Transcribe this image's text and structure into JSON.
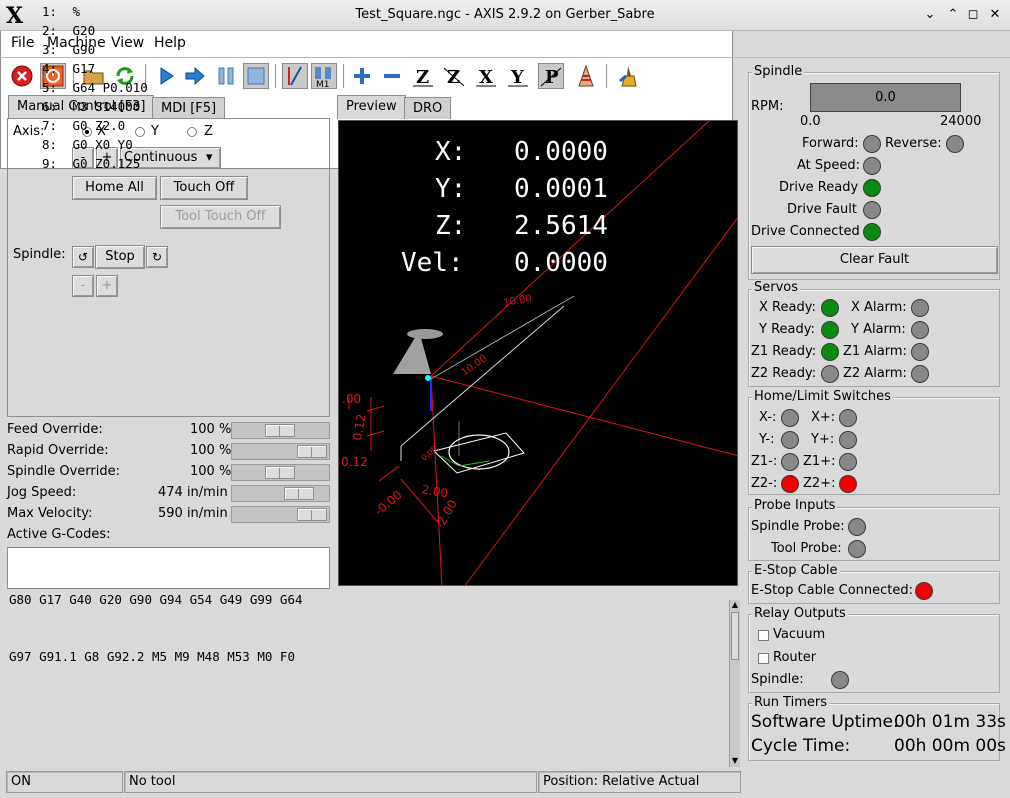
{
  "window": {
    "title": "Test_Square.ngc - AXIS 2.9.2 on Gerber_Sabre",
    "logo": "X",
    "minimize": "⌄",
    "maximize": "⌃",
    "restore": "◻",
    "close": "✕"
  },
  "menu": {
    "file": "File",
    "machine": "Machine",
    "view": "View",
    "help": "Help"
  },
  "toolbar": {
    "icons": [
      "estop-icon",
      "power-icon",
      "open-file-icon",
      "reload-icon",
      "run-icon",
      "step-icon",
      "pause-icon",
      "stop-icon",
      "block-delete-icon",
      "optional-stop-icon",
      "zoom-in-icon",
      "zoom-out-icon",
      "view-z-icon",
      "view-z2-icon",
      "view-x-icon",
      "view-y-icon",
      "view-p-icon",
      "rotate-icon",
      "clear-plot-icon"
    ],
    "labels": {
      "view_z": "Z",
      "view_z2": "Z",
      "view_x": "X",
      "view_y": "Y",
      "view_p": "P",
      "m1": "M1"
    }
  },
  "tabs_left": {
    "manual": "Manual Control [F3]",
    "mdi": "MDI [F5]"
  },
  "tabs_center": {
    "preview": "Preview",
    "dro": "DRO"
  },
  "manual": {
    "axis_label": "Axis:",
    "axes": [
      "X",
      "Y",
      "Z"
    ],
    "selected_axis": "X",
    "minus": "-",
    "plus": "+",
    "jog_mode": "Continuous",
    "home_all": "Home All",
    "touch_off": "Touch Off",
    "tool_touch_off": "Tool Touch Off",
    "spindle_label": "Spindle:",
    "spindle_stop": "Stop"
  },
  "overrides": [
    {
      "label": "Feed Override:",
      "value": "100 %"
    },
    {
      "label": "Rapid Override:",
      "value": "100 %"
    },
    {
      "label": "Spindle Override:",
      "value": "100 %"
    },
    {
      "label": "Jog Speed:",
      "value": "474 in/min"
    },
    {
      "label": "Max Velocity:",
      "value": "590 in/min"
    }
  ],
  "override_levels": {
    "feed": 0.5,
    "rapid": 1.0,
    "spindle": 0.5,
    "jog": 0.8,
    "max_velocity": 1.0
  },
  "gcodes": {
    "label": "Active G-Codes:",
    "line1": "G80 G17 G40 G20 G90 G94 G54 G49 G99 G64",
    "line2": "G97 G91.1 G8 G92.2 M5 M9 M48 M53 M0 F0"
  },
  "dro": {
    "x_label": "X:",
    "x": "0.0000",
    "y_label": "Y:",
    "y": "0.0001",
    "z_label": "Z:",
    "z": "2.5614",
    "vel_label": "Vel:",
    "vel": "0.0000"
  },
  "preview_labels": {
    "x_dim": "10.00",
    "y_dim": "10.00",
    "a1": ".00",
    "a2": "0.12",
    "a3": "0.12",
    "a4": "-0.00",
    "a5": "2.00",
    "a6": "2.00",
    "a7": "0.00"
  },
  "program": [
    {
      "n": "1:",
      "code": "%"
    },
    {
      "n": "2:",
      "code": "G20"
    },
    {
      "n": "3:",
      "code": "G90"
    },
    {
      "n": "4:",
      "code": "G17"
    },
    {
      "n": "5:",
      "code": "G64 P0.010"
    },
    {
      "n": "6:",
      "code": "M3 S14000"
    },
    {
      "n": "7:",
      "code": "G0 Z2.0"
    },
    {
      "n": "8:",
      "code": "G0 X0 Y0"
    },
    {
      "n": "9:",
      "code": "G0 Z0.125"
    }
  ],
  "status": {
    "state": "ON",
    "tool": "No tool",
    "position": "Position: Relative Actual"
  },
  "spindle_panel": {
    "title": "Spindle",
    "rpm_label": "RPM:",
    "rpm": "0.0",
    "rpm_min": "0.0",
    "rpm_max": "24000",
    "forward": "Forward:",
    "reverse": "Reverse:",
    "at_speed": "At Speed:",
    "drive_ready": "Drive Ready",
    "drive_fault": "Drive Fault",
    "drive_connected": "Drive Connected",
    "clear_fault": "Clear Fault",
    "colors": {
      "forward": "#888888",
      "reverse": "#888888",
      "at_speed": "#888888",
      "drive_ready": "#0b8a12",
      "drive_fault": "#888888",
      "drive_connected": "#0b8a12"
    }
  },
  "servos": {
    "title": "Servos",
    "rows": [
      {
        "ready": "X Ready:",
        "alarm": "X Alarm:"
      },
      {
        "ready": "Y Ready:",
        "alarm": "Y Alarm:"
      },
      {
        "ready": "Z1 Ready:",
        "alarm": "Z1 Alarm:"
      },
      {
        "ready": "Z2 Ready:",
        "alarm": "Z2 Alarm:"
      }
    ],
    "ready_colors": [
      "#0b8a12",
      "#0b8a12",
      "#0b8a12",
      "#888888"
    ],
    "alarm_colors": [
      "#888888",
      "#888888",
      "#888888",
      "#888888"
    ]
  },
  "limits": {
    "title": "Home/Limit Switches",
    "rows": [
      {
        "a": "X-:",
        "b": "X+:"
      },
      {
        "a": "Y-:",
        "b": "Y+:"
      },
      {
        "a": "Z1-:",
        "b": "Z1+:"
      },
      {
        "a": "Z2-:",
        "b": "Z2+:"
      }
    ],
    "a_colors": [
      "#888888",
      "#888888",
      "#888888",
      "#f20000"
    ],
    "b_colors": [
      "#888888",
      "#888888",
      "#888888",
      "#f20000"
    ]
  },
  "probe": {
    "title": "Probe Inputs",
    "spindle_probe": "Spindle Probe:",
    "tool_probe": "Tool Probe:"
  },
  "estop": {
    "title": "E-Stop Cable",
    "connected": "E-Stop Cable Connected:",
    "color": "#f20000"
  },
  "relay": {
    "title": "Relay Outputs",
    "vacuum": "Vacuum",
    "router": "Router",
    "spindle": "Spindle:"
  },
  "timers": {
    "title": "Run Timers",
    "uptime_label": "Software Uptime:",
    "uptime": "00h 01m 33s",
    "cycle_label": "Cycle Time:",
    "cycle": "00h 00m 00s"
  }
}
